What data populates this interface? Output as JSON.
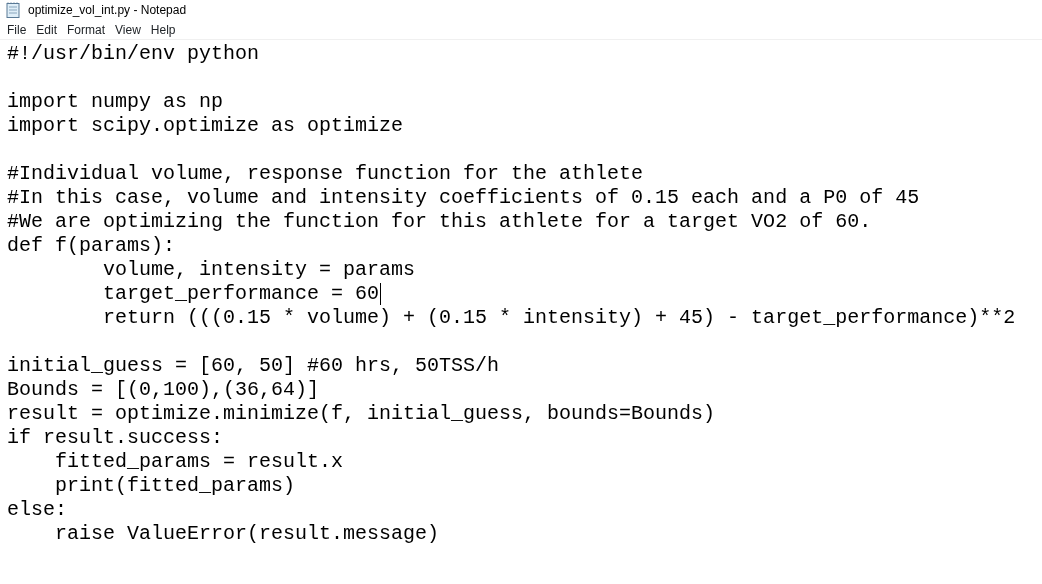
{
  "window": {
    "title": "optimize_vol_int.py - Notepad"
  },
  "menu": [
    "File",
    "Edit",
    "Format",
    "View",
    "Help"
  ],
  "editor": {
    "blocks": [
      {
        "lines": [
          {
            "text": "#!/usr/bin/env python",
            "caret": false
          }
        ]
      },
      {
        "lines": [
          {
            "text": "import numpy as np",
            "caret": false
          },
          {
            "text": "import scipy.optimize as optimize",
            "caret": false
          }
        ]
      },
      {
        "lines": [
          {
            "text": "#Individual volume, response function for the athlete",
            "caret": false
          },
          {
            "text": "#In this case, volume and intensity coefficients of 0.15 each and a P0 of 45",
            "caret": false
          },
          {
            "text": "#We are optimizing the function for this athlete for a target VO2 of 60.",
            "caret": false
          },
          {
            "text": "def f(params):",
            "caret": false
          },
          {
            "text": "        volume, intensity = params",
            "caret": false
          },
          {
            "text": "        target_performance = 60",
            "caret": true
          },
          {
            "text": "        return (((0.15 * volume) + (0.15 * intensity) + 45) - target_performance)**2",
            "caret": false
          }
        ]
      },
      {
        "lines": [
          {
            "text": "initial_guess = [60, 50] #60 hrs, 50TSS/h",
            "caret": false
          },
          {
            "text": "Bounds = [(0,100),(36,64)]",
            "caret": false
          },
          {
            "text": "result = optimize.minimize(f, initial_guess, bounds=Bounds)",
            "caret": false
          },
          {
            "text": "if result.success:",
            "caret": false
          },
          {
            "text": "    fitted_params = result.x",
            "caret": false
          },
          {
            "text": "    print(fitted_params)",
            "caret": false
          },
          {
            "text": "else:",
            "caret": false
          },
          {
            "text": "    raise ValueError(result.message)",
            "caret": false
          }
        ]
      }
    ]
  }
}
